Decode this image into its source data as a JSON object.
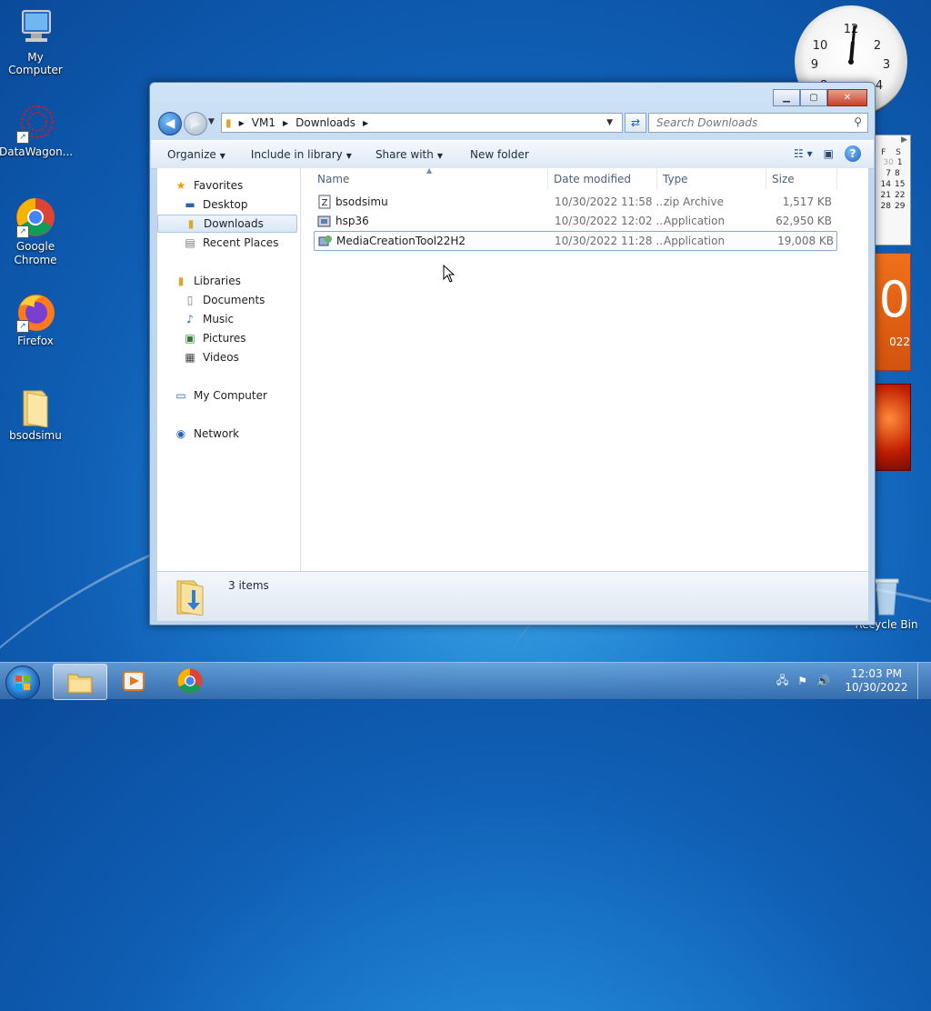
{
  "desktop": {
    "icons": [
      {
        "label": "My Computer"
      },
      {
        "label": "DataWagon..."
      },
      {
        "label": "Google\nChrome"
      },
      {
        "label": "Firefox"
      },
      {
        "label": "bsodsimu"
      },
      {
        "label": "Recycle Bin"
      }
    ],
    "calendar": {
      "header": "F S",
      "rows": [
        [
          "30",
          "1"
        ],
        [
          "7",
          "8"
        ],
        [
          "14",
          "15"
        ],
        [
          "21",
          "22"
        ],
        [
          "28",
          "29"
        ]
      ],
      "big_digit": "0",
      "year_fragment": "022"
    }
  },
  "window": {
    "breadcrumb": [
      "VM1",
      "Downloads"
    ],
    "search_placeholder": "Search Downloads",
    "commands": {
      "organize": "Organize",
      "include_in_library": "Include in library",
      "share_with": "Share with",
      "new_folder": "New folder"
    },
    "nav": {
      "favorites": "Favorites",
      "desktop": "Desktop",
      "downloads": "Downloads",
      "recent_places": "Recent Places",
      "libraries": "Libraries",
      "documents": "Documents",
      "music": "Music",
      "pictures": "Pictures",
      "videos": "Videos",
      "my_computer": "My Computer",
      "network": "Network"
    },
    "columns": {
      "name": "Name",
      "date_modified": "Date modified",
      "type": "Type",
      "size": "Size"
    },
    "files": [
      {
        "name": "bsodsimu",
        "date": "10/30/2022 11:58 ...",
        "type": "zip Archive",
        "size": "1,517 KB"
      },
      {
        "name": "hsp36",
        "date": "10/30/2022 12:02 ...",
        "type": "Application",
        "size": "62,950 KB"
      },
      {
        "name": "MediaCreationTool22H2",
        "date": "10/30/2022 11:28 ...",
        "type": "Application",
        "size": "19,008 KB"
      }
    ],
    "status": {
      "item_count": "3 items"
    }
  },
  "taskbar": {
    "time": "12:03 PM",
    "date": "10/30/2022"
  }
}
